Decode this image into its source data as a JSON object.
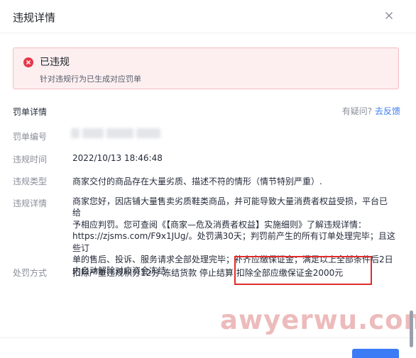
{
  "dialog": {
    "title": "违规详情"
  },
  "alert": {
    "status": "已违规",
    "description": "针对违规行为已生成对应罚单"
  },
  "section": {
    "title": "罚单详情",
    "feedback_question": "有疑问?",
    "feedback_link": "去反馈"
  },
  "details": {
    "ticket_number_label": "罚单编号",
    "time_label": "违规时间",
    "time_value": "2022/10/13 18:46:48",
    "type_label": "违规类型",
    "type_value": "商家交付的商品存在大量劣质、描述不符的情形（情节特别严重）.",
    "detail_label": "违规详情",
    "detail_lines": [
      "商家您好，因店铺大量售卖劣质鞋类商品，并可能导致大量消费者权益受损，平台已给",
      "予相应判罚。您可查阅《【商家—危及消费者权益】实施细则》了解违规详情：",
      "https://zjsms.com/F9x1JUg/。处罚满30天；判罚前产生的所有订单处理完毕；且这些订",
      "单的售后、投诉、服务请求全部处理完毕；补齐应缴保证金；满足以上全部条件后2日",
      "内自动解除对应资金冻结"
    ],
    "penalty_label": "处罚方式",
    "penalty_value": "扣除严重违规积分12分 冻结货款 停止结算 扣除全部应缴保证金2000元"
  },
  "watermark": "awyerwu.com",
  "colors": {
    "primary": "#3b7cf6",
    "alert_background": "#fdeff0",
    "alert_border": "#f5bcc2",
    "error_icon": "#e5394b",
    "highlight_box": "#e02b2b"
  },
  "icons": {
    "close": "close-icon",
    "error": "error-circle-icon"
  }
}
